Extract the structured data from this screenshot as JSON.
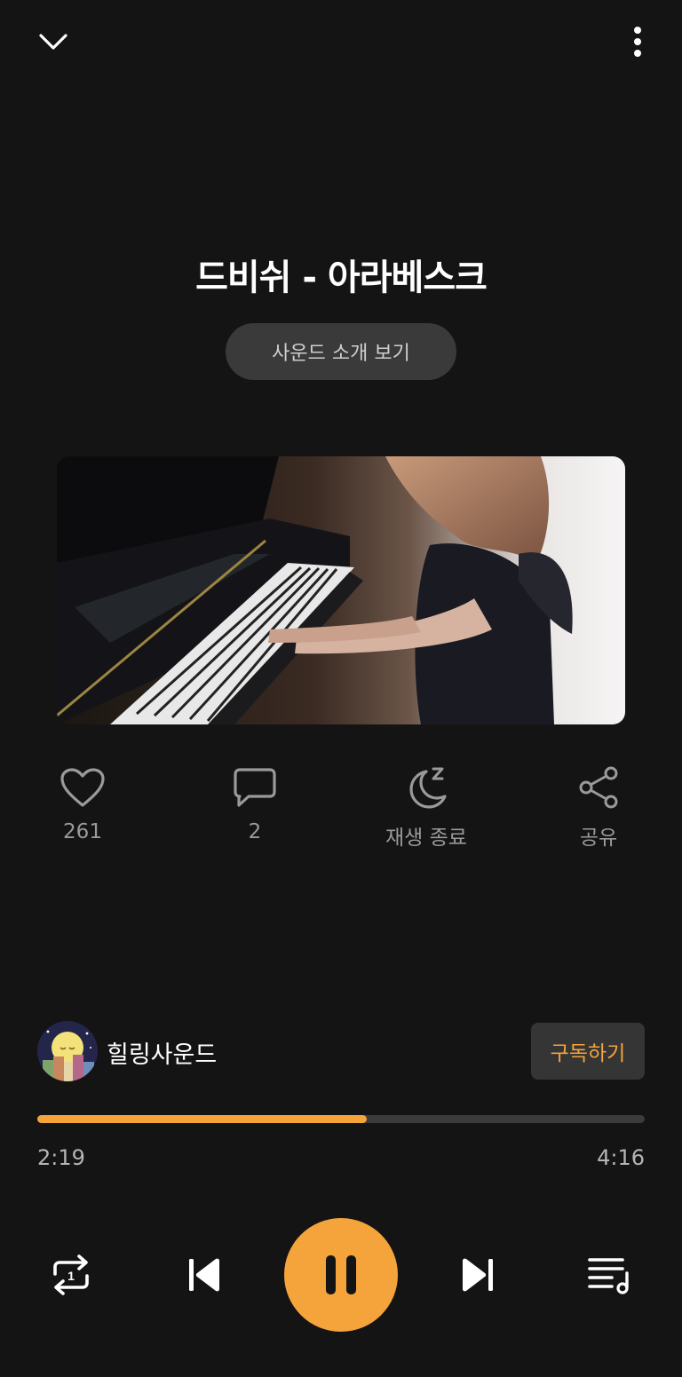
{
  "player": {
    "title": "드비쉬 - 아라베스크",
    "intro_label": "사운드 소개 보기",
    "artwork_icon": "piano-player-photo"
  },
  "actions": {
    "like": {
      "icon": "heart-icon",
      "label": "261"
    },
    "comment": {
      "icon": "comment-icon",
      "label": "2"
    },
    "sleep_timer": {
      "icon": "moon-sleep-icon",
      "label": "재생 종료"
    },
    "share": {
      "icon": "share-icon",
      "label": "공유"
    }
  },
  "channel": {
    "name": "힐링사운드",
    "subscribe_label": "구독하기"
  },
  "progress": {
    "current": "2:19",
    "total": "4:16",
    "fraction": 0.543
  },
  "controls": {
    "repeat_icon": "repeat-one-icon",
    "prev_icon": "skip-previous-icon",
    "play_icon": "pause-icon",
    "next_icon": "skip-next-icon",
    "playlist_icon": "playlist-icon"
  },
  "colors": {
    "accent": "#f5a43b",
    "background": "#141414",
    "muted": "#9a9a9a"
  }
}
